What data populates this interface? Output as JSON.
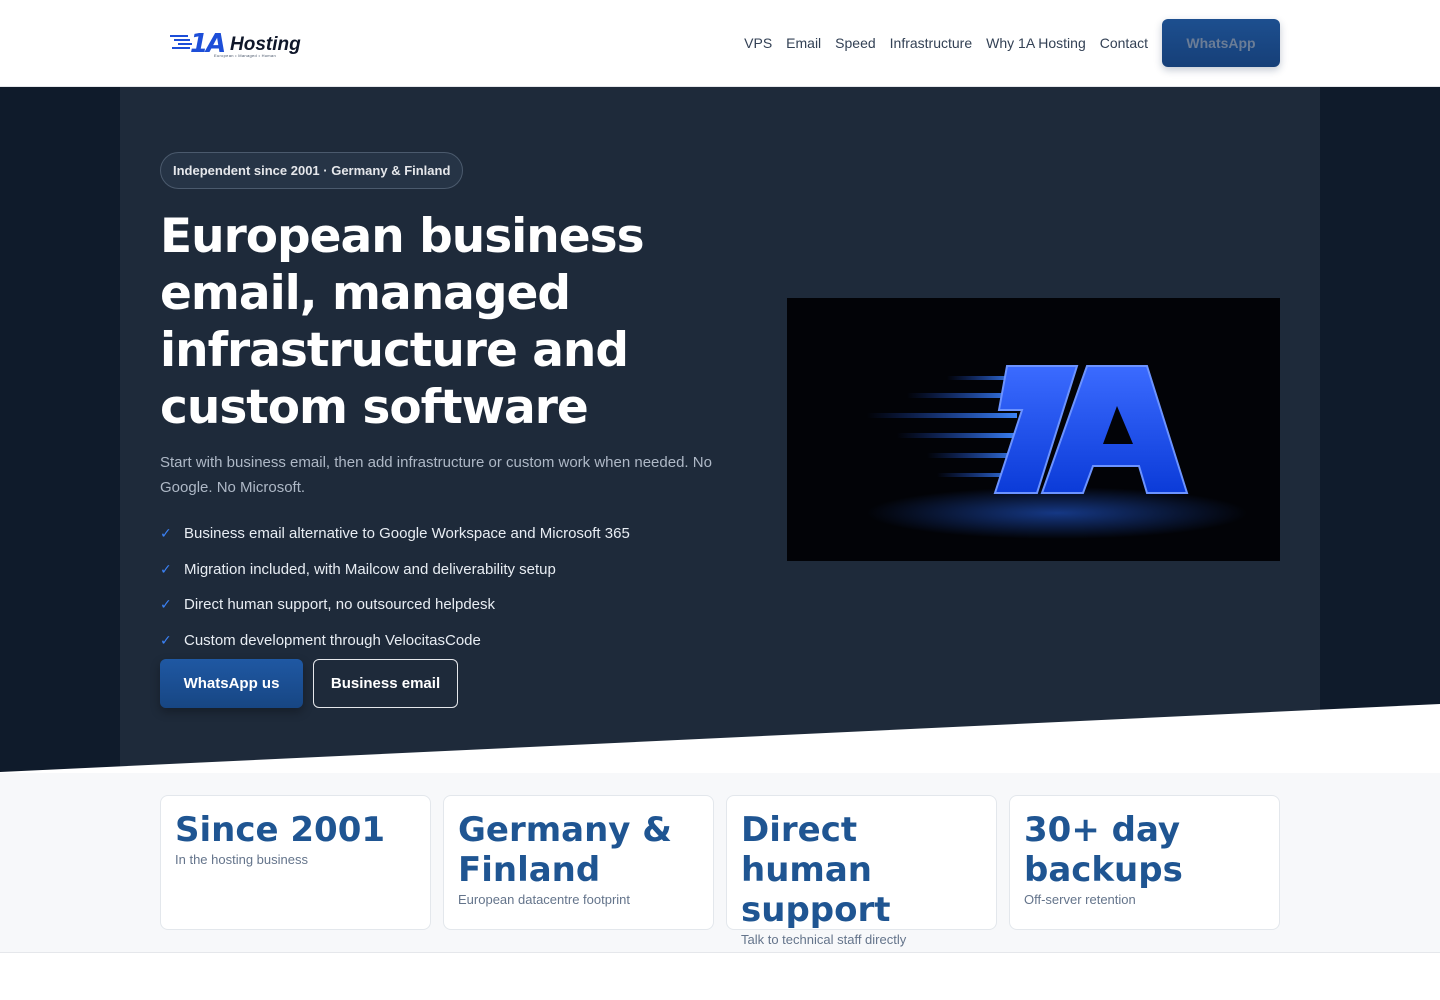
{
  "header": {
    "logo_text": "1A Hosting",
    "logo_tagline": "European • Managed • Human",
    "nav": [
      "VPS",
      "Email",
      "Speed",
      "Infrastructure",
      "Why 1A Hosting",
      "Contact"
    ],
    "cta_label": "WhatsApp"
  },
  "hero": {
    "badge": "Independent since 2001 · Germany & Finland",
    "title": "European business email, managed infrastructure and custom software",
    "subtitle": "Start with business email, then add infrastructure or custom work when needed. No Google. No Microsoft.",
    "checks": [
      "Business email alternative to Google Workspace and Microsoft 365",
      "Migration included, with Mailcow and deliverability setup",
      "Direct human support, no outsourced helpdesk",
      "Custom development through VelocitasCode"
    ],
    "check_icon": "checkmark-icon",
    "primary_button": "WhatsApp us",
    "secondary_button": "Business email",
    "image_text": "1A"
  },
  "stats": [
    {
      "value": "Since 2001",
      "label": "In the hosting business"
    },
    {
      "value": "Germany & Finland",
      "label": "European datacentre footprint"
    },
    {
      "value": "Direct human support",
      "label": "Talk to technical staff directly"
    },
    {
      "value": "30+ day backups",
      "label": "Off-server retention"
    }
  ],
  "colors": {
    "brand_blue": "#1f5592",
    "hero_bg": "#1e2a3a",
    "hero_outer": "#0f1b2b",
    "accent": "#3b82f6"
  }
}
